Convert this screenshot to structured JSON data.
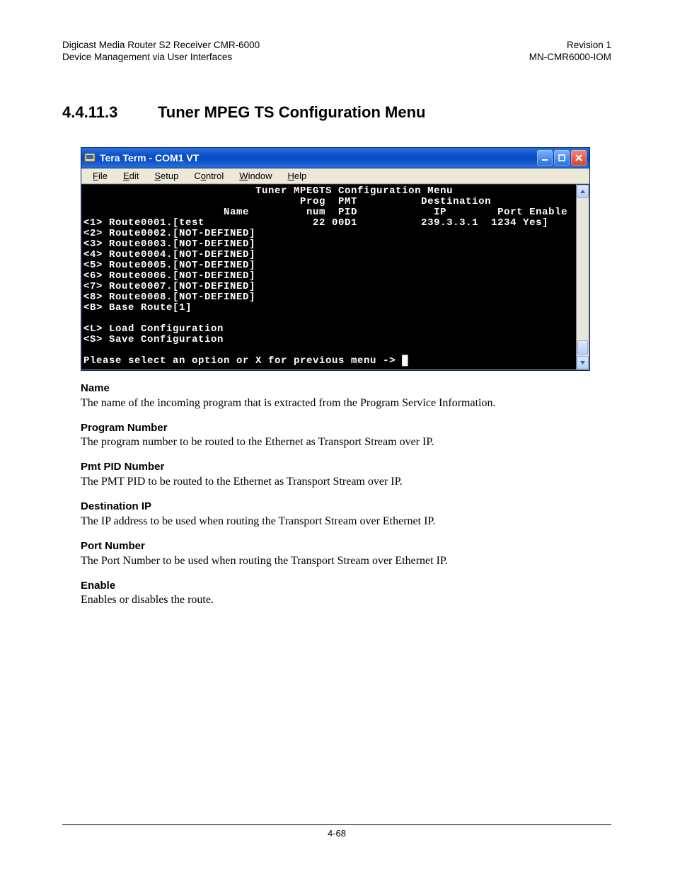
{
  "header": {
    "left1": "Digicast Media Router S2 Receiver CMR-6000",
    "left2": "Device Management via User Interfaces",
    "right1": "Revision 1",
    "right2": "MN-CMR6000-IOM"
  },
  "section": {
    "number": "4.4.11.3",
    "title": "Tuner MPEG TS Configuration Menu"
  },
  "window": {
    "title": "Tera Term - COM1 VT",
    "menus": [
      "File",
      "Edit",
      "Setup",
      "Control",
      "Window",
      "Help"
    ],
    "terminal": {
      "title": "Tuner MPEGTS Configuration Menu",
      "columns": {
        "name": "Name",
        "prog1": "Prog",
        "prog2": "num",
        "pmt1": "PMT",
        "pmt2": "PID",
        "dest": "Destination",
        "ip": "IP",
        "port": "Port",
        "enable": "Enable"
      },
      "routes": [
        {
          "key": "1",
          "id": "Route0001",
          "name": "test",
          "prog": "22",
          "pmt": "00D1",
          "ip": "239.3.3.1",
          "port": "1234",
          "enable": "Yes",
          "defined": true
        },
        {
          "key": "2",
          "id": "Route0002",
          "name": "NOT-DEFINED",
          "defined": false
        },
        {
          "key": "3",
          "id": "Route0003",
          "name": "NOT-DEFINED",
          "defined": false
        },
        {
          "key": "4",
          "id": "Route0004",
          "name": "NOT-DEFINED",
          "defined": false
        },
        {
          "key": "5",
          "id": "Route0005",
          "name": "NOT-DEFINED",
          "defined": false
        },
        {
          "key": "6",
          "id": "Route0006",
          "name": "NOT-DEFINED",
          "defined": false
        },
        {
          "key": "7",
          "id": "Route0007",
          "name": "NOT-DEFINED",
          "defined": false
        },
        {
          "key": "8",
          "id": "Route0008",
          "name": "NOT-DEFINED",
          "defined": false
        }
      ],
      "base": {
        "key": "B",
        "label": "Base Route[1]"
      },
      "load": {
        "key": "L",
        "label": "Load Configuration"
      },
      "save": {
        "key": "S",
        "label": "Save Configuration"
      },
      "prompt": "Please select an option or X for previous menu ->"
    }
  },
  "defs": [
    {
      "term": "Name",
      "desc": "The name of the incoming program that is extracted from the Program Service Information."
    },
    {
      "term": "Program Number",
      "desc": "The program number to be routed to the Ethernet as Transport Stream over IP."
    },
    {
      "term": "Pmt PID Number",
      "desc": "The PMT PID to be routed to the Ethernet as Transport Stream over IP."
    },
    {
      "term": "Destination IP",
      "desc": "The IP address to be used when routing the Transport Stream over Ethernet IP."
    },
    {
      "term": "Port Number",
      "desc": "The Port Number to be used when routing the Transport Stream over Ethernet IP."
    },
    {
      "term": "Enable",
      "desc": "Enables or disables the route."
    }
  ],
  "footer": {
    "page": "4-68"
  }
}
